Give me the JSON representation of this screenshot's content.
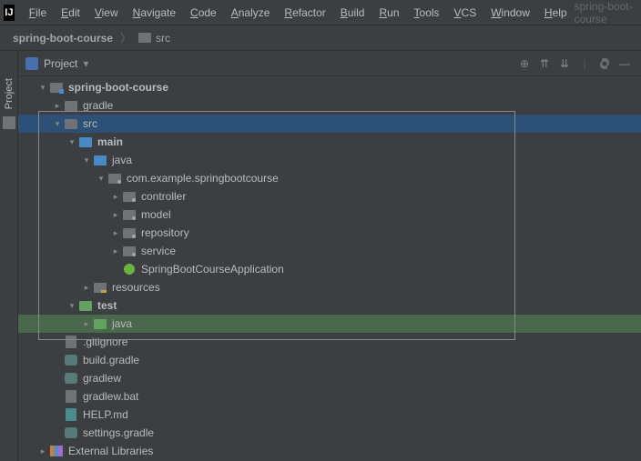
{
  "menubar": {
    "items": [
      "File",
      "Edit",
      "View",
      "Navigate",
      "Code",
      "Analyze",
      "Refactor",
      "Build",
      "Run",
      "Tools",
      "VCS",
      "Window",
      "Help"
    ],
    "project_hint": "spring-boot-course"
  },
  "breadcrumb": {
    "root": "spring-boot-course",
    "path": [
      "src"
    ]
  },
  "project_panel": {
    "title": "Project"
  },
  "sidebar": {
    "tab": "Project"
  },
  "tree": [
    {
      "depth": 0,
      "arrow": "down",
      "icon": "module",
      "label": "spring-boot-course",
      "bold": true
    },
    {
      "depth": 1,
      "arrow": "right",
      "icon": "folder-grey",
      "label": "gradle"
    },
    {
      "depth": 1,
      "arrow": "down",
      "icon": "folder-grey",
      "label": "src",
      "selected": true
    },
    {
      "depth": 2,
      "arrow": "down",
      "icon": "folder-blue",
      "label": "main",
      "bold": true
    },
    {
      "depth": 3,
      "arrow": "down",
      "icon": "folder-blue",
      "label": "java"
    },
    {
      "depth": 4,
      "arrow": "down",
      "icon": "package",
      "label": "com.example.springbootcourse"
    },
    {
      "depth": 5,
      "arrow": "right",
      "icon": "package",
      "label": "controller"
    },
    {
      "depth": 5,
      "arrow": "right",
      "icon": "package",
      "label": "model"
    },
    {
      "depth": 5,
      "arrow": "right",
      "icon": "package",
      "label": "repository"
    },
    {
      "depth": 5,
      "arrow": "right",
      "icon": "package",
      "label": "service"
    },
    {
      "depth": 5,
      "arrow": "none",
      "icon": "spring",
      "label": "SpringBootCourseApplication"
    },
    {
      "depth": 3,
      "arrow": "right",
      "icon": "resources",
      "label": "resources"
    },
    {
      "depth": 2,
      "arrow": "down",
      "icon": "folder-green",
      "label": "test",
      "bold": true
    },
    {
      "depth": 3,
      "arrow": "right",
      "icon": "folder-green",
      "label": "java",
      "selgreen": true
    },
    {
      "depth": 1,
      "arrow": "none",
      "icon": "file",
      "label": ".gitignore"
    },
    {
      "depth": 1,
      "arrow": "none",
      "icon": "elephant",
      "label": "build.gradle"
    },
    {
      "depth": 1,
      "arrow": "none",
      "icon": "elephant",
      "label": "gradlew"
    },
    {
      "depth": 1,
      "arrow": "none",
      "icon": "file",
      "label": "gradlew.bat"
    },
    {
      "depth": 1,
      "arrow": "none",
      "icon": "md",
      "label": "HELP.md"
    },
    {
      "depth": 1,
      "arrow": "none",
      "icon": "elephant",
      "label": "settings.gradle"
    },
    {
      "depth": 0,
      "arrow": "right",
      "icon": "lib",
      "label": "External Libraries"
    }
  ]
}
